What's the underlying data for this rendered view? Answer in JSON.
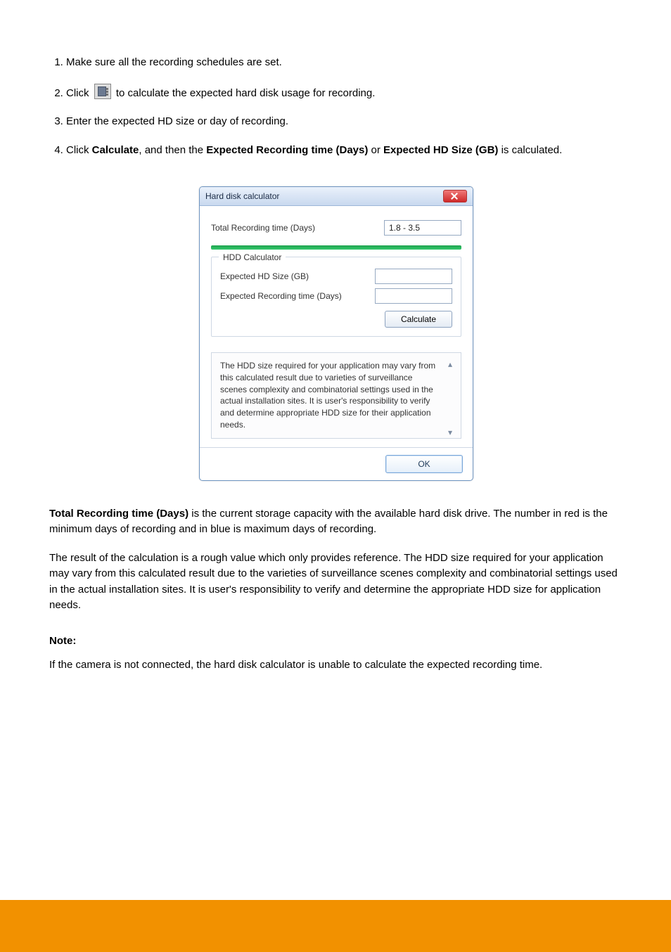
{
  "steps": [
    "Make sure all the recording schedules are set.",
    "Click %ICON% to calculate the expected hard disk usage for recording.",
    "Enter the expected HD size or day of recording.",
    "Click <b>Calculate</b>, and then the <b>Expected Recording time (Days)</b> or <b>Expected HD Size (GB)</b> is calculated."
  ],
  "dialog": {
    "title": "Hard disk calculator",
    "total_label": "Total Recording time (Days)",
    "total_value": "1.8 - 3.5",
    "group_legend": "HDD Calculator",
    "size_label": "Expected HD Size (GB)",
    "size_value": "",
    "days_label": "Expected Recording time (Days)",
    "days_value": "",
    "calc_label": "Calculate",
    "notice": "The HDD size required for your application may vary from this calculated result due to varieties of surveillance scenes complexity and combinatorial settings used in the actual installation sites. It is user's responsibility to verify and determine appropriate HDD size for their application needs.",
    "ok_label": "OK"
  },
  "paragraphs": {
    "p1_html": "<b>Total Recording time (Days)</b> is the current storage capacity with the available hard disk drive. The number in red is the minimum days of recording and in blue is maximum days of recording.",
    "p2_html": "The result of the calculation is a rough value which only provides reference. The **HDD size required for your application** may vary from this calculated result due to the varieties of surveillance scenes complexity and combinatorial settings used in the actual installation sites. It is user's responsibility to verify and determine the appropriate HDD size for application needs."
  },
  "note": {
    "heading": "Note:",
    "body": "If the camera is not connected, the hard disk calculator is unable to calculate the expected recording time."
  }
}
